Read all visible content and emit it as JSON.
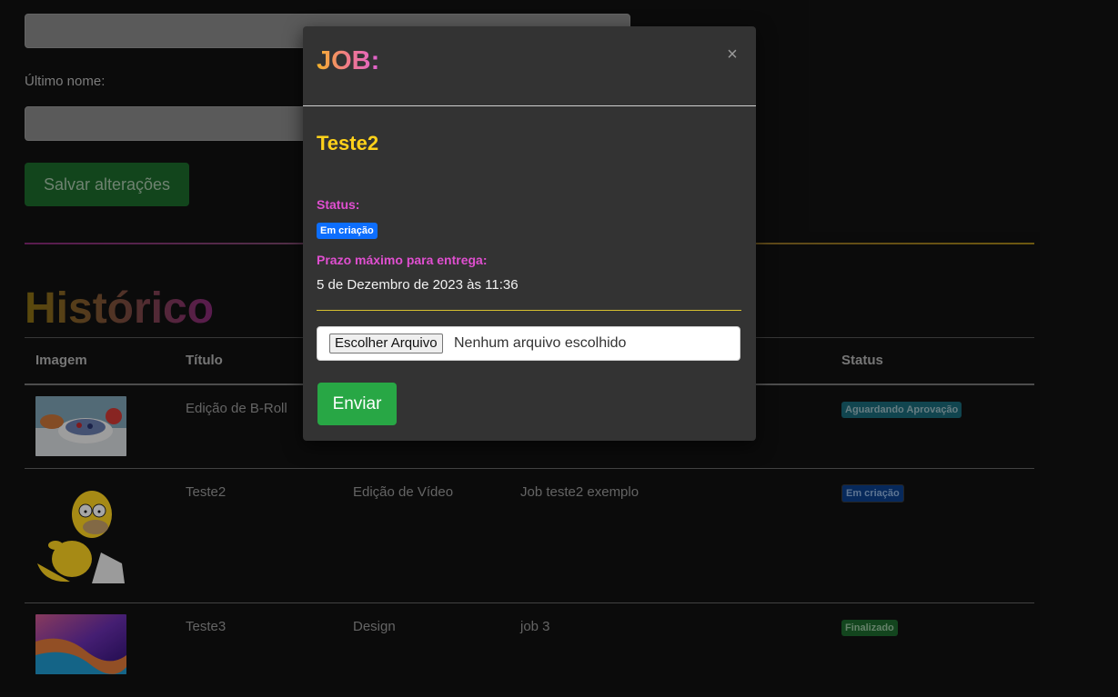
{
  "profile": {
    "last_name_label": "Último nome:",
    "save_label": "Salvar alterações"
  },
  "history": {
    "title": "Histórico",
    "columns": [
      "Imagem",
      "Título",
      "Status"
    ],
    "rows": [
      {
        "title": "Edição de B-Roll",
        "category": "",
        "description": "",
        "status": "Aguardando Aprovação",
        "status_color": "#1b6a7a",
        "image": "food-thumbnail"
      },
      {
        "title": "Teste2",
        "category": "Edição de Vídeo",
        "description": "Job teste2 exemplo",
        "status": "Em criação",
        "status_color": "#0b3f8c",
        "image": "homer-thumbnail"
      },
      {
        "title": "Teste3",
        "category": "Design",
        "description": "job 3",
        "status": "Finalizado",
        "status_color": "#1e6a2e",
        "image": "abstract-thumbnail"
      }
    ]
  },
  "modal": {
    "title": "JOB:",
    "close_icon": "close-icon",
    "job_name": "Teste2",
    "status_label": "Status:",
    "status_value": "Em criação",
    "deadline_label": "Prazo máximo para entrega:",
    "deadline_value": "5 de Dezembro de 2023 às 11:36",
    "file_button_label": "Escolher Arquivo",
    "file_status": "Nenhum arquivo escolhido",
    "send_label": "Enviar"
  }
}
